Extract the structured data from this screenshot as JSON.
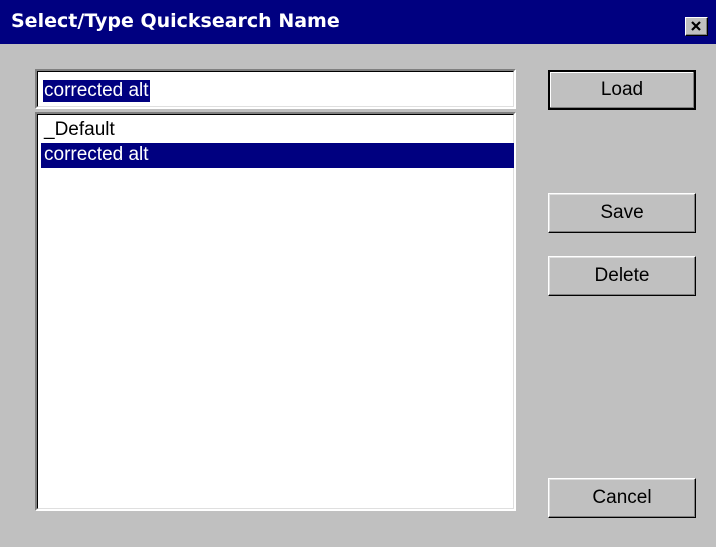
{
  "dialog": {
    "title": "Select/Type Quicksearch Name",
    "close_icon": "close-x-icon"
  },
  "name_input": {
    "value": "corrected alt"
  },
  "list": {
    "items": [
      {
        "label": "_Default",
        "selected": false
      },
      {
        "label": "corrected alt",
        "selected": true
      }
    ]
  },
  "buttons": {
    "load": "Load",
    "save": "Save",
    "delete": "Delete",
    "cancel": "Cancel"
  },
  "colors": {
    "titlebar": "#000080",
    "face": "#c0c0c0",
    "selection": "#000080"
  }
}
